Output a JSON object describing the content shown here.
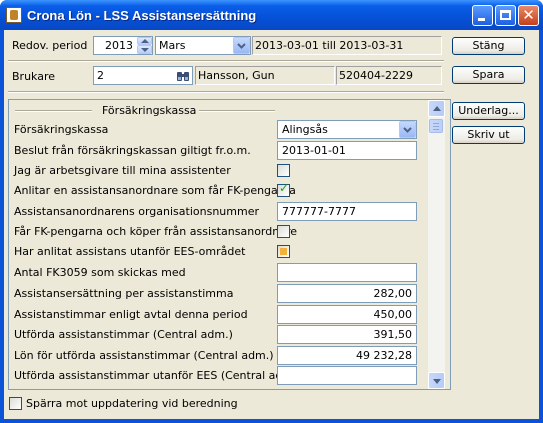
{
  "window": {
    "title": "Crona Lön - LSS Assistansersättning"
  },
  "colors": {
    "titlebar": "#0a5ee8",
    "face": "#ece9d8",
    "field_border": "#7f9db9",
    "check_green": "#21a121",
    "warning_dot": "#f3b33a"
  },
  "header": {
    "period_label": "Redov. period",
    "year": "2013",
    "month": "Mars",
    "date_range": "2013-03-01 till 2013-03-31",
    "close_button": "Stäng",
    "user_label": "Brukare",
    "user_id": "2",
    "user_name": "Hansson, Gun",
    "user_pnr": "520404-2229",
    "save_button": "Spara"
  },
  "side_buttons": {
    "attachments": "Underlag...",
    "print": "Skriv ut"
  },
  "panel": {
    "section_title": "Försäkringskassa",
    "rows": [
      {
        "label": "Försäkringskassa",
        "type": "dropdown",
        "value": "Alingsås"
      },
      {
        "label": "Beslut från försäkringskassan giltigt fr.o.m.",
        "type": "text",
        "value": "2013-01-01"
      },
      {
        "label": "Jag är arbetsgivare till mina assistenter",
        "type": "checkbox",
        "checked": false
      },
      {
        "label": "Anlitar en assistansanordnare som får FK-pengarna",
        "type": "checkbox",
        "checked": true
      },
      {
        "label": "Assistansanordnarens organisationsnummer",
        "type": "text",
        "value": "777777-7777"
      },
      {
        "label": "Får FK-pengarna och köper från assistansanordnare",
        "type": "checkbox",
        "checked": false
      },
      {
        "label": "Har anlitat assistans utanför EES-området",
        "type": "checkbox",
        "checked": false,
        "indeterminate": true
      },
      {
        "label": "Antal FK3059 som skickas med",
        "type": "text",
        "value": ""
      },
      {
        "label": "Assistansersättning per assistanstimma",
        "type": "number",
        "value": "282,00"
      },
      {
        "label": "Assistanstimmar enligt avtal denna period",
        "type": "number",
        "value": "450,00"
      },
      {
        "label": "Utförda assistanstimmar (Central adm.)",
        "type": "number",
        "value": "391,50"
      },
      {
        "label": "Lön för utförda assistanstimmar (Central adm.)",
        "type": "number",
        "value": "49 232,28"
      },
      {
        "label": "Utförda assistanstimmar utanför EES (Central adm.)",
        "type": "number",
        "value": ""
      }
    ]
  },
  "footer": {
    "lock_label": "Spärra mot uppdatering vid beredning",
    "lock_checked": false
  }
}
